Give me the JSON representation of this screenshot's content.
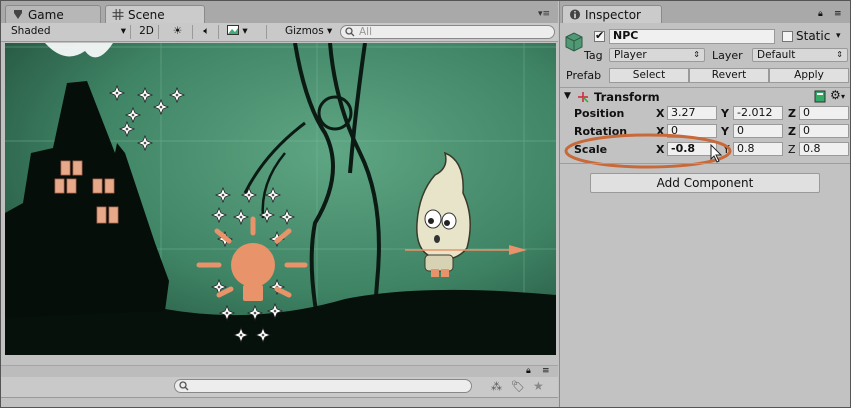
{
  "tabs": {
    "game": "Game",
    "scene": "Scene"
  },
  "scene_toolbar": {
    "render_mode": "Shaded",
    "mode_2d": "2D",
    "gizmos": "Gizmos",
    "search_placeholder": "All"
  },
  "inspector": {
    "tab": "Inspector",
    "object_name": "NPC",
    "static_label": "Static",
    "tag_label": "Tag",
    "tag_value": "Player",
    "layer_label": "Layer",
    "layer_value": "Default",
    "prefab_label": "Prefab",
    "prefab_buttons": [
      "Select",
      "Revert",
      "Apply"
    ],
    "component_title": "Transform",
    "position_label": "Position",
    "rotation_label": "Rotation",
    "scale_label": "Scale",
    "axis": {
      "x": "X",
      "y": "Y",
      "z": "Z"
    },
    "position": {
      "x": "3.27",
      "y": "-2.012",
      "z": "0"
    },
    "rotation": {
      "x": "0",
      "y": "0",
      "z": "0"
    },
    "scale": {
      "x": "-0.8",
      "y": "0.8",
      "z": "0.8"
    },
    "add_component": "Add Component"
  },
  "colors": {
    "highlight_ellipse": "#c8693a",
    "scene_bg": "#3f8465",
    "handle": "#e8936a"
  }
}
